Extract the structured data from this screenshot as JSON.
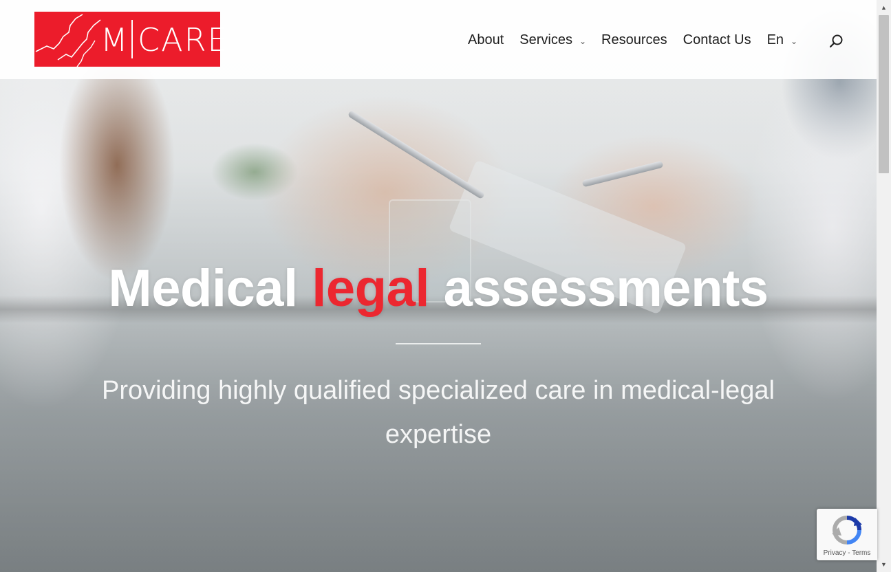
{
  "header": {
    "logo_text_left": "M",
    "logo_text_right": "CARE",
    "brand_color": "#ec1c2b"
  },
  "nav": {
    "items": [
      {
        "label": "About",
        "has_dropdown": false
      },
      {
        "label": "Services",
        "has_dropdown": true
      },
      {
        "label": "Resources",
        "has_dropdown": false
      },
      {
        "label": "Contact Us",
        "has_dropdown": false
      },
      {
        "label": "En",
        "has_dropdown": true
      }
    ],
    "search_icon": "search-icon",
    "chevron_icon": "chevron-down-icon"
  },
  "hero": {
    "headline_part1": "Medical",
    "headline_accent": "legal",
    "headline_part2": "assessments",
    "accent_color": "#ec2730",
    "subtitle": "Providing highly qualified specialized care in medical-legal expertise"
  },
  "recaptcha": {
    "privacy": "Privacy",
    "separator": "-",
    "terms": "Terms",
    "icon": "recaptcha-icon"
  }
}
